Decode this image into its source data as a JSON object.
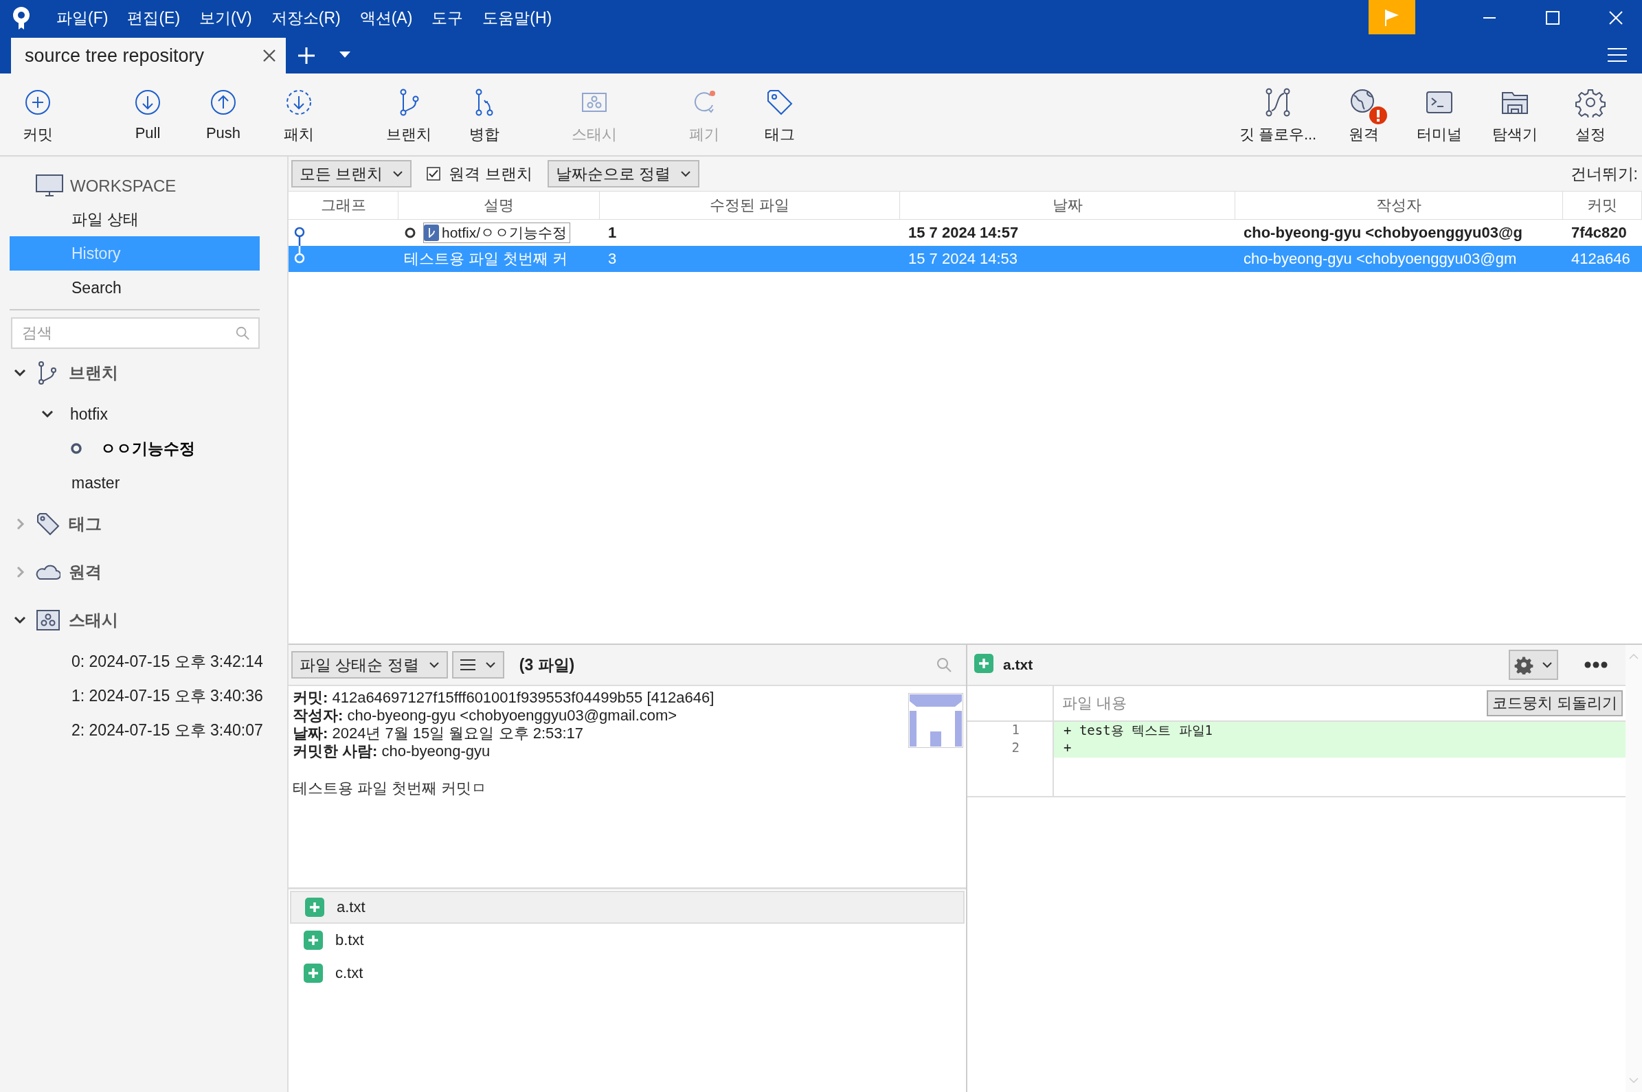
{
  "menu": [
    "파일(F)",
    "편집(E)",
    "보기(V)",
    "저장소(R)",
    "액션(A)",
    "도구",
    "도움말(H)"
  ],
  "tab": {
    "title": "source tree repository"
  },
  "toolbar": {
    "left_groups": [
      [
        {
          "kind": "commit",
          "label": "커밋",
          "disabled": false
        }
      ],
      [
        {
          "kind": "pull",
          "label": "Pull",
          "disabled": false
        },
        {
          "kind": "push",
          "label": "Push",
          "disabled": false
        },
        {
          "kind": "patch",
          "label": "패치",
          "disabled": false
        }
      ],
      [
        {
          "kind": "branch",
          "label": "브랜치",
          "disabled": false
        },
        {
          "kind": "merge",
          "label": "병합",
          "disabled": false
        }
      ],
      [
        {
          "kind": "stash",
          "label": "스태시",
          "disabled": true
        }
      ],
      [
        {
          "kind": "discard",
          "label": "폐기",
          "disabled": true
        },
        {
          "kind": "tag",
          "label": "태그",
          "disabled": false
        }
      ]
    ],
    "right": [
      {
        "kind": "gitflow",
        "label": "깃 플로우...",
        "alert": false
      },
      {
        "kind": "remote",
        "label": "원격",
        "alert": true
      },
      {
        "kind": "terminal",
        "label": "터미널",
        "alert": false
      },
      {
        "kind": "explorer",
        "label": "탐색기",
        "alert": false
      },
      {
        "kind": "settings",
        "label": "설정",
        "alert": false
      }
    ]
  },
  "sidebar": {
    "workspace": "WORKSPACE",
    "nav": [
      {
        "label": "파일 상태",
        "selected": false
      },
      {
        "label": "History",
        "selected": true
      },
      {
        "label": "Search",
        "selected": false
      }
    ],
    "search": {
      "placeholder": "검색"
    },
    "sections": [
      {
        "kind": "branch",
        "label": "브랜치",
        "expanded": true,
        "children": [
          {
            "label": "hotfix",
            "expanded": true,
            "children": [
              {
                "label": "ㅇㅇ기능수정",
                "current": true
              }
            ]
          },
          {
            "label": "master",
            "current": false
          }
        ]
      },
      {
        "kind": "tag",
        "label": "태그",
        "expanded": false
      },
      {
        "kind": "cloud",
        "label": "원격",
        "expanded": false
      },
      {
        "kind": "stash",
        "label": "스태시",
        "expanded": true,
        "children": [
          {
            "label": "0: 2024-07-15 오후 3:42:14"
          },
          {
            "label": "1: 2024-07-15 오후 3:40:36"
          },
          {
            "label": "2: 2024-07-15 오후 3:40:07"
          }
        ]
      }
    ]
  },
  "filters": {
    "branches": "모든 브랜치",
    "remote_branches": {
      "label": "원격 브랜치",
      "checked": true
    },
    "sort": "날짜순으로 정렬",
    "jump": "건너뛰기:"
  },
  "commits": {
    "columns": [
      "그래프",
      "설명",
      "수정된 파일",
      "날짜",
      "작성자",
      "커밋"
    ],
    "rows": [
      {
        "selected": false,
        "current": true,
        "branch": "hotfix/ㅇㅇ기능수정",
        "files": "1",
        "date": "15 7 2024 14:57",
        "author": "cho-byeong-gyu <chobyoenggyu03@g",
        "commit": "7f4c820"
      },
      {
        "selected": true,
        "current": false,
        "description": "테스트용 파일 첫번째 커",
        "files": "3",
        "date": "15 7 2024 14:53",
        "author": "cho-byeong-gyu <chobyoenggyu03@gm",
        "commit": "412a646"
      }
    ]
  },
  "details": {
    "sort": "파일 상태순 정렬",
    "count": "(3 파일)",
    "fields": [
      {
        "label": "커밋:",
        "value": "412a64697127f15fff601001f939553f04499b55 [412a646]"
      },
      {
        "label": "작성자:",
        "value": "cho-byeong-gyu <chobyoenggyu03@gmail.com>"
      },
      {
        "label": "날짜:",
        "value": "2024년 7월 15일 월요일 오후 2:53:17"
      },
      {
        "label": "커밋한 사람:",
        "value": "cho-byeong-gyu"
      }
    ],
    "message": "테스트용 파일 첫번째 커밋ㅁ",
    "files": [
      {
        "name": "a.txt",
        "kind": "added",
        "selected": true
      },
      {
        "name": "b.txt",
        "kind": "added",
        "selected": false
      },
      {
        "name": "c.txt",
        "kind": "added",
        "selected": false
      }
    ]
  },
  "diff": {
    "file": {
      "name": "a.txt",
      "kind": "added"
    },
    "header": "파일 내용",
    "revert": "코드뭉치 되돌리기",
    "lines": [
      {
        "number": "1",
        "text": "+ test용 텍스트 파일1",
        "kind": "added"
      },
      {
        "number": "2",
        "text": "+",
        "kind": "added"
      }
    ]
  }
}
